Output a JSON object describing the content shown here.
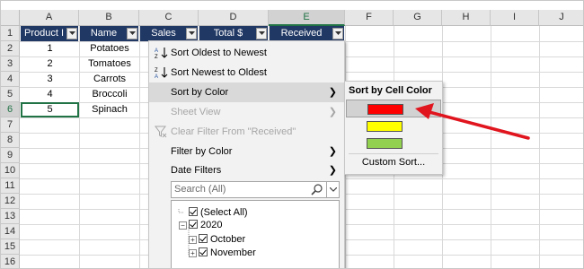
{
  "columns": [
    "A",
    "B",
    "C",
    "D",
    "E",
    "F",
    "G",
    "H",
    "I",
    "J"
  ],
  "rows": [
    "1",
    "2",
    "3",
    "4",
    "5",
    "6",
    "7",
    "8",
    "9",
    "10",
    "11",
    "12",
    "13",
    "14",
    "15",
    "16"
  ],
  "headers": {
    "a": "Product I",
    "b": "Name",
    "c": "Sales",
    "d": "Total $",
    "e": "Received"
  },
  "data_rows": [
    {
      "id": "1",
      "name": "Potatoes"
    },
    {
      "id": "2",
      "name": "Tomatoes"
    },
    {
      "id": "3",
      "name": "Carrots"
    },
    {
      "id": "4",
      "name": "Broccoli"
    },
    {
      "id": "5",
      "name": "Spinach"
    }
  ],
  "menu": {
    "sort_oldest": "Sort Oldest to Newest",
    "sort_newest": "Sort Newest to Oldest",
    "sort_by_color": "Sort by Color",
    "sheet_view": "Sheet View",
    "clear_filter": "Clear Filter From \"Received\"",
    "filter_by_color": "Filter by Color",
    "date_filters": "Date Filters",
    "search_placeholder": "Search (All)",
    "tree": {
      "select_all": "(Select All)",
      "year": "2020",
      "months": [
        "October",
        "November"
      ]
    }
  },
  "submenu": {
    "title": "Sort by Cell Color",
    "colors": [
      "#ff0000",
      "#ffff00",
      "#92d050"
    ],
    "custom_sort": "Custom Sort..."
  },
  "colors": {
    "header_fill": "#203864",
    "excel_green": "#217346",
    "arrow_red": "#e0151e"
  }
}
